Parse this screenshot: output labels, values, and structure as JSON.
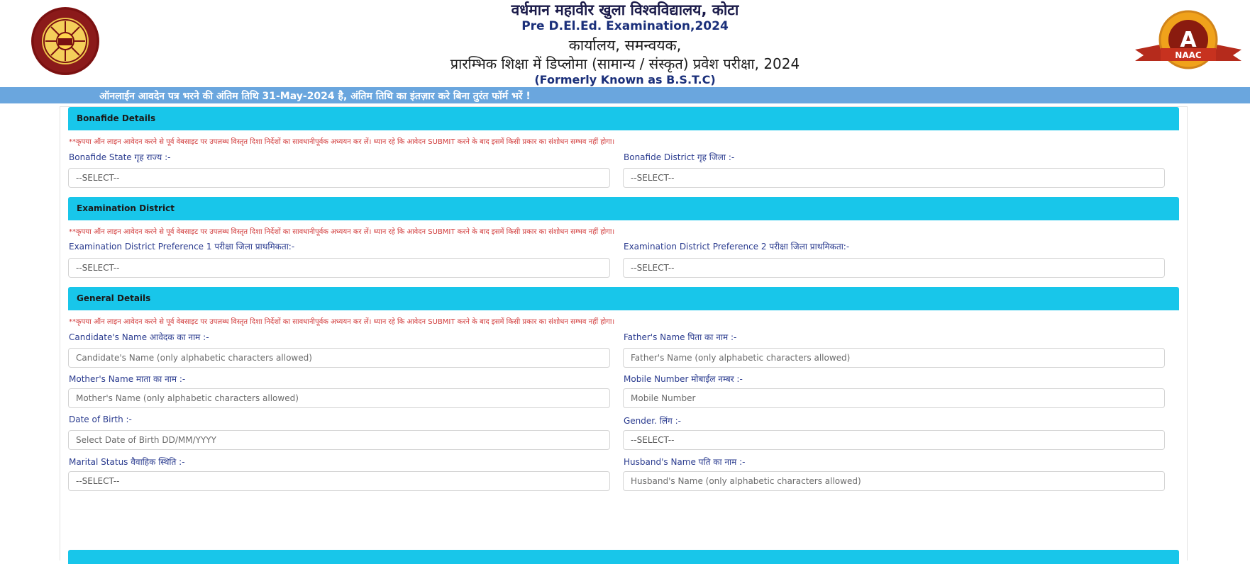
{
  "header": {
    "hindi_university": "वर्धमान महावीर खुला विश्वविद्यालय, कोटा",
    "exam_title": "Pre D.El.Ed. Examination,2024",
    "hindi_office": "कार्यालय, समन्वयक,",
    "hindi_program": "प्रारम्भिक शिक्षा में डिप्लोमा (सामान्य / संस्कृत) प्रवेश परीक्षा, 2024",
    "formerly": "(Formerly Known as B.S.T.C)",
    "naac_grade": "A",
    "naac_label": "NAAC"
  },
  "notice": "ऑनलाईन आवदेन पत्र भरने की अंतिम तिथि 31-May-2024 है, अंतिम तिथि का इंतज़ार करे बिना तुरंत फॉर्म भरें !",
  "note_text": "**कृपया ऑन लाइन आवेदन करने से पूर्व वेबसाइट पर उपलब्ध विस्तृत दिशा निर्देशों का सावधानीपूर्वक अध्ययन कर लें। ध्यान रहे कि आवेदन SUBMIT करने के बाद इसमें किसी प्रकार का संशोधन सम्भव नहीं होगा।",
  "sections": {
    "bonafide": {
      "title": "Bonafide Details",
      "state_label": "Bonafide State गृह राज्य :-",
      "state_value": "--SELECT--",
      "district_label": "Bonafide District गृह जिला :-",
      "district_value": "--SELECT--"
    },
    "exam_district": {
      "title": "Examination District",
      "pref1_label": "Examination District Preference 1 परीक्षा जिला प्राथमिकता:-",
      "pref1_value": "--SELECT--",
      "pref2_label": "Examination District Preference 2 परीक्षा जिला प्राथमिकता:-",
      "pref2_value": "--SELECT--"
    },
    "general": {
      "title": "General Details",
      "candidate_label": "Candidate's Name आवेदक का नाम :-",
      "candidate_placeholder": "Candidate's Name (only alphabetic characters allowed)",
      "father_label": "Father's Name पिता का नाम :-",
      "father_placeholder": "Father's Name (only alphabetic characters allowed)",
      "mother_label": "Mother's Name माता का नाम :-",
      "mother_placeholder": "Mother's Name (only alphabetic characters allowed)",
      "mobile_label": "Mobile Number मोबाईल नम्बर :-",
      "mobile_placeholder": "Mobile Number",
      "dob_label": "Date of Birth :-",
      "dob_placeholder": "Select Date of Birth DD/MM/YYYY",
      "gender_label": "Gender. लिंग :-",
      "gender_value": "--SELECT--",
      "marital_label": "Marital Status वैवाहिक स्थिति :-",
      "marital_value": "--SELECT--",
      "husband_label": "Husband's Name पति का नाम :-",
      "husband_placeholder": "Husband's Name (only alphabetic characters allowed)"
    }
  },
  "colors": {
    "section_header": "#18c6ea",
    "notice_bar": "#6aa6de",
    "label_text": "#2a3b8f",
    "note_text": "#d13a3a"
  }
}
